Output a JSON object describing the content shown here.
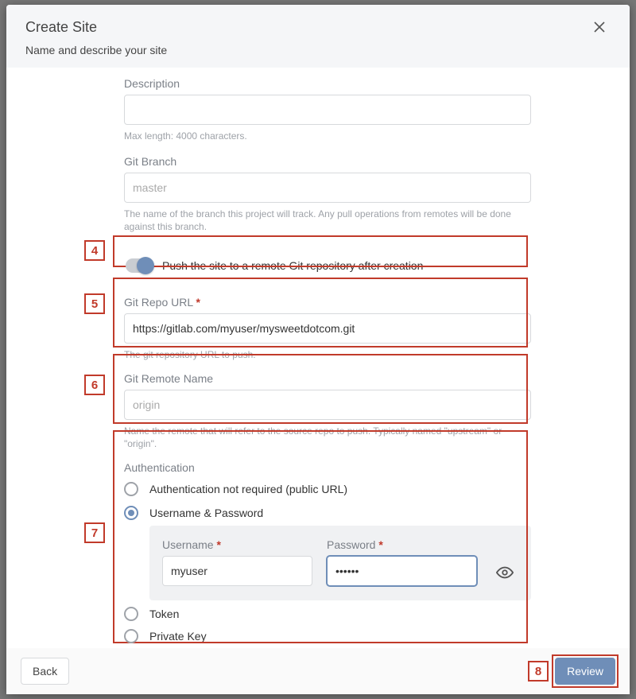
{
  "modal": {
    "title": "Create Site",
    "subtitle": "Name and describe your site"
  },
  "fields": {
    "description": {
      "label": "Description",
      "value": "",
      "hint": "Max length: 4000 characters."
    },
    "branch": {
      "label": "Git Branch",
      "placeholder": "master",
      "value": "",
      "hint": "The name of the branch this project will track. Any pull operations from remotes will be done against this branch."
    },
    "pushToggle": {
      "on": true,
      "label": "Push the site to a remote Git repository after creation"
    },
    "repoUrl": {
      "label": "Git Repo URL",
      "required": true,
      "value": "https://gitlab.com/myuser/mysweetdotcom.git",
      "hint": "The git repository URL to push."
    },
    "remoteName": {
      "label": "Git Remote Name",
      "placeholder": "origin",
      "value": "",
      "hint": "Name the remote that will refer to the source repo to push. Typically named \"upstream\" or \"origin\"."
    }
  },
  "auth": {
    "title": "Authentication",
    "options": [
      {
        "id": "none",
        "label": "Authentication not required (public URL)",
        "selected": false
      },
      {
        "id": "userpass",
        "label": "Username & Password",
        "selected": true
      },
      {
        "id": "token",
        "label": "Token",
        "selected": false
      },
      {
        "id": "privatekey",
        "label": "Private Key",
        "selected": false
      }
    ],
    "username": {
      "label": "Username",
      "required": true,
      "value": "myuser"
    },
    "password": {
      "label": "Password",
      "required": true,
      "value": "••••••"
    }
  },
  "footer": {
    "back": "Back",
    "review": "Review"
  },
  "steps": {
    "s4": "4",
    "s5": "5",
    "s6": "6",
    "s7": "7",
    "s8": "8"
  }
}
